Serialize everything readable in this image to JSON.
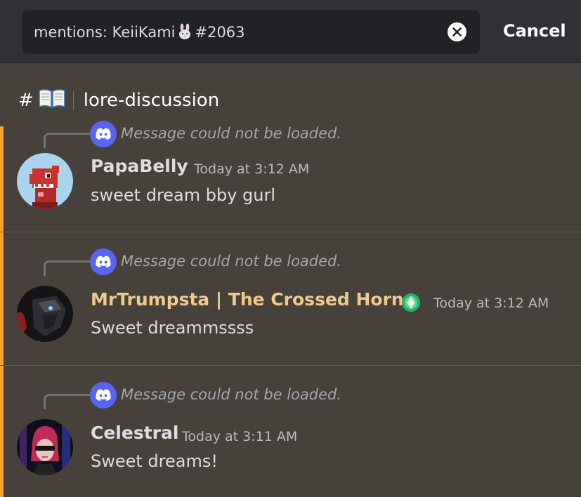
{
  "search": {
    "query_prefix": "mentions: KeiiKami",
    "query_suffix": "#2063",
    "cancel_label": "Cancel"
  },
  "channel": {
    "hash": "#",
    "name": "lore-discussion"
  },
  "results": [
    {
      "reply_text": "Message could not be loaded.",
      "username": "PapaBelly",
      "username_color": "#ffffff",
      "timestamp": "Today at 3:12 AM",
      "message": "sweet dream bby gurl"
    },
    {
      "reply_text": "Message could not be loaded.",
      "username": "MrTrumpsta | The Crossed Horns",
      "username_color": "#f1c98a",
      "timestamp": "Today at 3:12 AM",
      "message": "Sweet dreammssss"
    },
    {
      "reply_text": "Message could not be loaded.",
      "username": "Celestral",
      "username_color": "#ffffff",
      "timestamp": "Today at 3:11 AM",
      "message": "Sweet dreams!"
    }
  ],
  "colors": {
    "accent": "#f0a232",
    "discord_blurple": "#5865f2",
    "background": "#46423b",
    "topbar": "#2f3136"
  },
  "icons": [
    "clear-icon",
    "rabbit-emoji-icon",
    "book-emoji-icon",
    "discord-logo-icon",
    "nitro-gem-icon"
  ]
}
